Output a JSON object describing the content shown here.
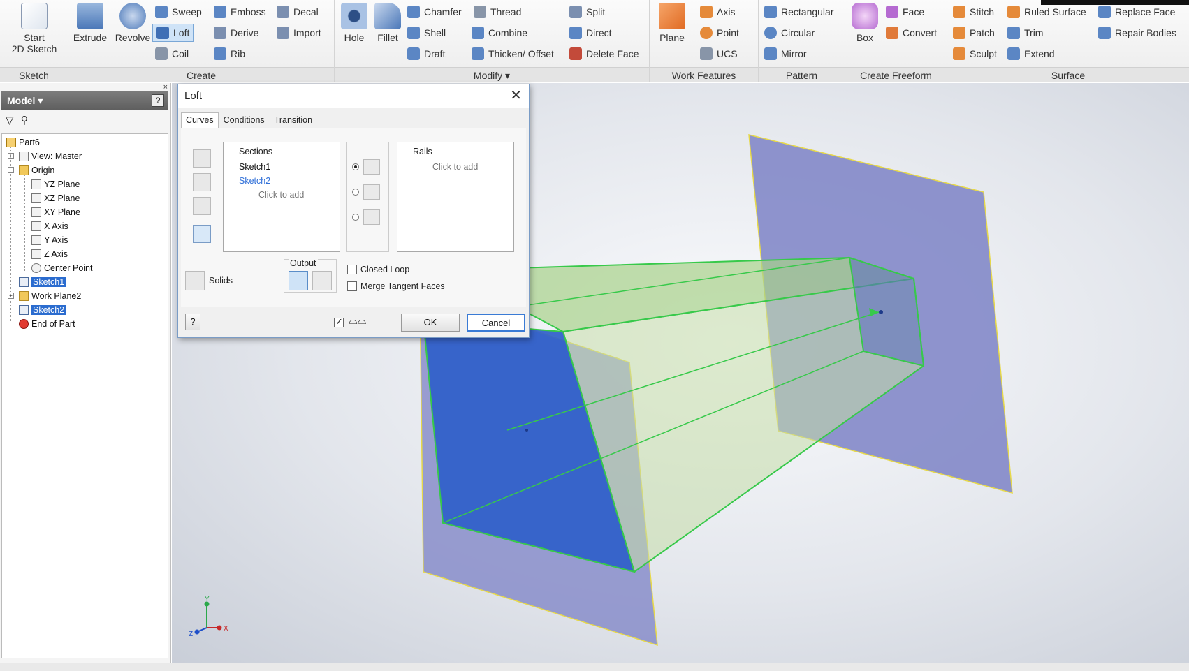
{
  "ribbon": {
    "groups": [
      {
        "label": "Sketch"
      },
      {
        "label": "Create"
      },
      {
        "label": "Modify ▾"
      },
      {
        "label": "Work Features"
      },
      {
        "label": "Pattern"
      },
      {
        "label": "Create Freeform"
      },
      {
        "label": "Surface"
      }
    ],
    "sketch": {
      "start_line1": "Start",
      "start_line2": "2D Sketch"
    },
    "create": {
      "extrude": "Extrude",
      "revolve": "Revolve",
      "sweep": "Sweep",
      "loft": "Loft",
      "coil": "Coil",
      "emboss": "Emboss",
      "derive": "Derive",
      "rib": "Rib",
      "decal": "Decal",
      "import": "Import"
    },
    "modify": {
      "hole": "Hole",
      "fillet": "Fillet",
      "chamfer": "Chamfer",
      "shell": "Shell",
      "draft": "Draft",
      "thread": "Thread",
      "combine": "Combine",
      "thicken": "Thicken/ Offset",
      "split": "Split",
      "direct": "Direct",
      "delete_face": "Delete Face"
    },
    "work": {
      "plane": "Plane",
      "axis": "Axis",
      "point": "Point",
      "ucs": "UCS"
    },
    "pattern": {
      "rectangular": "Rectangular",
      "circular": "Circular",
      "mirror": "Mirror"
    },
    "freeform": {
      "box": "Box",
      "face": "Face",
      "convert": "Convert"
    },
    "surface": {
      "stitch": "Stitch",
      "patch": "Patch",
      "sculpt": "Sculpt",
      "ruled": "Ruled Surface",
      "trim": "Trim",
      "extend": "Extend",
      "replace": "Replace Face",
      "repair": "Repair Bodies"
    }
  },
  "browser": {
    "title": "Model ▾",
    "close": "×",
    "help": "?",
    "tree": {
      "part": "Part6",
      "view": "View: Master",
      "origin": "Origin",
      "yz": "YZ Plane",
      "xz": "XZ Plane",
      "xy": "XY Plane",
      "x_axis": "X Axis",
      "y_axis": "Y Axis",
      "z_axis": "Z Axis",
      "center": "Center Point",
      "sketch1": "Sketch1",
      "work_plane2": "Work Plane2",
      "sketch2": "Sketch2",
      "end": "End of Part"
    }
  },
  "dialog": {
    "title": "Loft",
    "close": "✕",
    "tabs": [
      "Curves",
      "Conditions",
      "Transition"
    ],
    "sections_header": "Sections",
    "sections": [
      "Sketch1",
      "Sketch2"
    ],
    "click_to_add": "Click to add",
    "rails_header": "Rails",
    "output_label": "Output",
    "solids_label": "Solids",
    "closed_loop": "Closed Loop",
    "merge_tangent": "Merge Tangent Faces",
    "ok": "OK",
    "cancel": "Cancel",
    "help": "?"
  },
  "viewcube": {
    "y": "Y",
    "x": "X",
    "z": "Z"
  },
  "colors": {
    "accent": "#2b6ccf",
    "sketch_highlight": "#2f6fd8",
    "loft_preview": "#a8d28a",
    "edge_green": "#37c94a",
    "face_blue": "#2f5fc9",
    "plane_purple": "#7c82c6"
  }
}
